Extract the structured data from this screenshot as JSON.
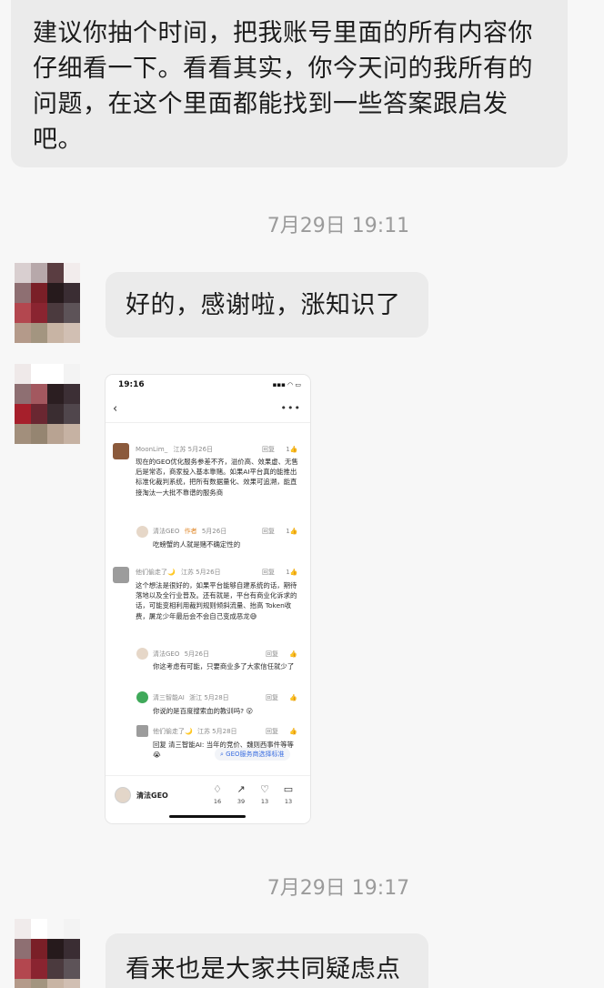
{
  "messages": [
    {
      "side": "right",
      "text": "建议你抽个时间，把我账号里面的所有内容你仔细看一下。看看其实，你今天问的我所有的问题，在这个里面都能找到一些答案跟启发吧。"
    },
    {
      "timestamp": "7月29日 19:11"
    },
    {
      "side": "left",
      "text": "好的，感谢啦，涨知识了"
    },
    {
      "side": "left",
      "type": "image"
    },
    {
      "timestamp": "7月29日 19:17"
    },
    {
      "side": "left",
      "text": "看来也是大家共同疑虑点"
    }
  ],
  "chat": {
    "msg1": "建议你抽个时间，把我账号里面的所有内容你仔细看一下。看看其实，你今天问的我所有的问题，在这个里面都能找到一些答案跟启发吧。",
    "ts1": "7月29日 19:11",
    "msg2": "好的，感谢啦，涨知识了",
    "ts2": "7月29日 19:17",
    "msg3": "看来也是大家共同疑虑点"
  },
  "screenshot": {
    "status_time": "19:16",
    "status_icons": "▪▪▪ ◠ ▭",
    "back_icon": "‹",
    "more_icon": "•••",
    "comments": [
      {
        "user": "MoonLim_",
        "meta": "江苏  5月26日",
        "reply_label": "回复",
        "likes": "1",
        "text": "现在的GEO优化服务参差不齐，溢价高、效果虚、无售后是常态，商家投入基本靠赌。如果AI平台真的能推出标准化裁判系统，把所有数据量化、效果可追溯，能直接淘汰一大批不靠谱的服务商",
        "reply": {
          "user": "清法GEO",
          "tag": "作者",
          "meta": "5月26日",
          "reply_label": "回复",
          "likes": "1",
          "text": "吃螃蟹的人就是赌不确定性的"
        }
      },
      {
        "user": "他们偷走了🌙",
        "meta": "江苏  5月26日",
        "reply_label": "回复",
        "likes": "1",
        "text": "这个想法是很好的，如果平台能够自建系统的话，期待落地以及全行业普及。还有就是，平台有商业化诉求的话，可能变相利用裁判规则倾斜流量、抬高 Token收费，屠龙少年最后会不会自己变成恶龙😅",
        "replies": [
          {
            "user": "清法GEO",
            "meta": "5月26日",
            "reply_label": "回复",
            "text": "你这考虑有可能，只要商业多了大家信任就少了"
          },
          {
            "user": "清三智能AI",
            "meta": "浙江  5月28日",
            "reply_label": "回复",
            "text": "你说的是百度搜索血的教训吗? 😮"
          },
          {
            "user": "他们偷走了🌙",
            "meta": "江苏  5月28日",
            "reply_label": "回复",
            "text": "回复 清三智能AI: 当年的竞价、魏则西事件等等😭"
          }
        ]
      }
    ],
    "search_chip": "GEO服务商选择标准",
    "bottom": {
      "author": "清法GEO",
      "actions": [
        {
          "icon": "♢",
          "count": "16"
        },
        {
          "icon": "↗",
          "count": "39"
        },
        {
          "icon": "♡",
          "count": "13"
        },
        {
          "icon": "▭",
          "count": "13"
        }
      ]
    }
  },
  "colors": {
    "page_bg": "#f7f7f7",
    "bubble_bg": "#ebebeb",
    "timestamp": "#9b9b9b",
    "author_tag": "#e08a2e",
    "search_link": "#3b6ee0"
  }
}
